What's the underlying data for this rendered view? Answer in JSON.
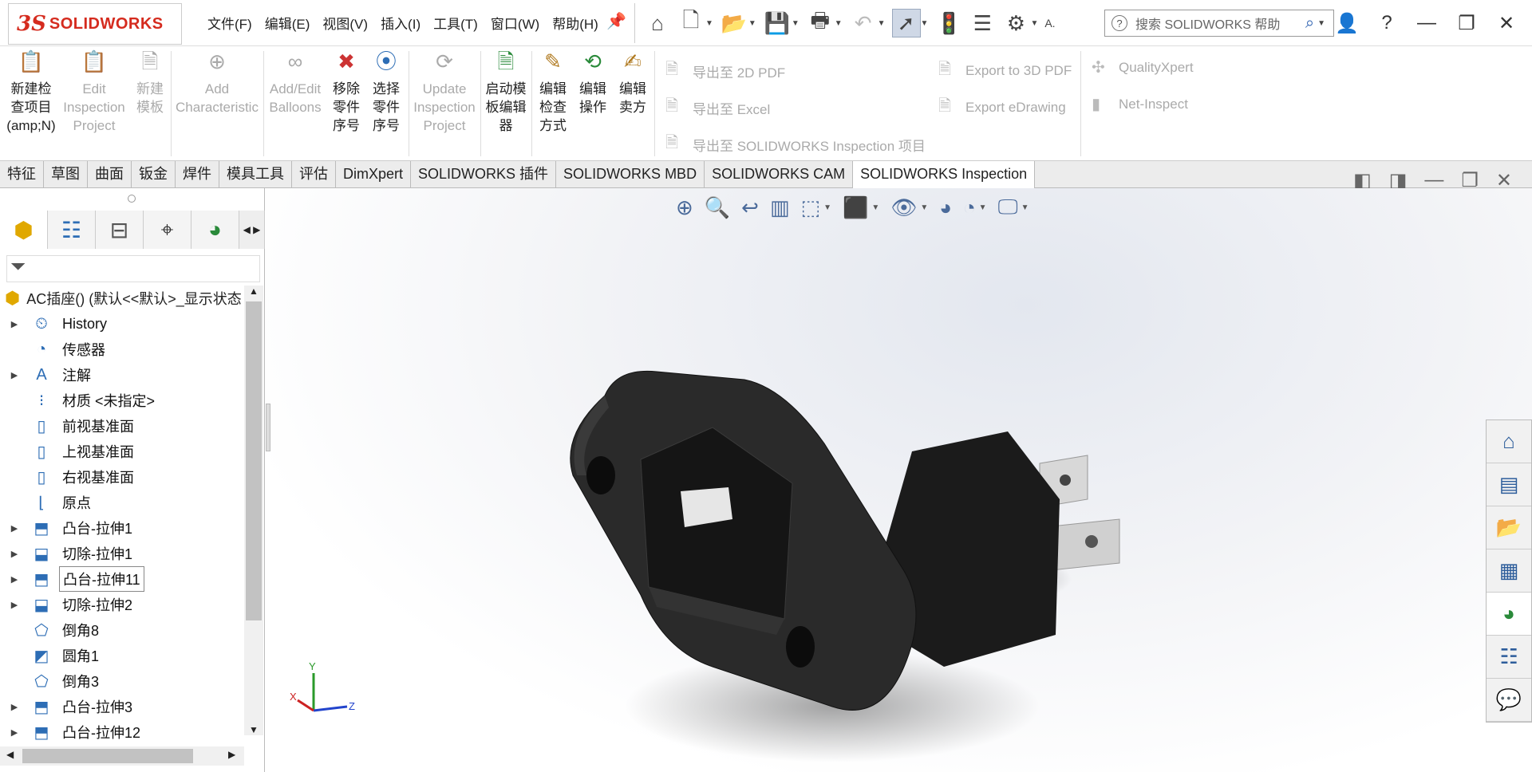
{
  "app": {
    "brand_ds": "3S",
    "brand_name": "SOLIDWORKS"
  },
  "menu": [
    "文件(F)",
    "编辑(E)",
    "视图(V)",
    "插入(I)",
    "工具(T)",
    "窗口(W)",
    "帮助(H)"
  ],
  "search": {
    "placeholder": "搜索 SOLIDWORKS 帮助",
    "prefix": "A."
  },
  "ribbon": {
    "new_inspection": "新建检\n查项目\n(amp;N)",
    "edit_inspection": "Edit\nInspection\nProject",
    "new_template": "新建\n模板",
    "add_characteristic": "Add\nCharacteristic",
    "add_edit_balloons": "Add/Edit\nBalloons",
    "remove_part_number": "移除\n零件\n序号",
    "select_part_number": "选择\n零件\n序号",
    "update_inspection": "Update\nInspection\nProject",
    "launch_template_editor": "启动模\n板编辑\n器",
    "edit_inspection_method": "编辑\n检查\n方式",
    "edit_operation": "编辑\n操作",
    "edit_vendor": "编辑\n卖方",
    "export_2d_pdf": "导出至 2D PDF",
    "export_excel": "导出至 Excel",
    "export_inspection": "导出至 SOLIDWORKS Inspection 项目",
    "export_3d_pdf": "Export to 3D PDF",
    "export_edrawing": "Export eDrawing",
    "qualityxpert": "QualityXpert",
    "net_inspect": "Net-Inspect"
  },
  "command_tabs": [
    "特征",
    "草图",
    "曲面",
    "钣金",
    "焊件",
    "模具工具",
    "评估",
    "DimXpert",
    "SOLIDWORKS 插件",
    "SOLIDWORKS MBD",
    "SOLIDWORKS CAM",
    "SOLIDWORKS Inspection"
  ],
  "active_tab": "SOLIDWORKS Inspection",
  "tree": {
    "root": "AC插座() (默认<<默认>_显示状态",
    "items": [
      {
        "label": "History",
        "expandable": true,
        "icon": "history-icon"
      },
      {
        "label": "传感器",
        "expandable": false,
        "icon": "sensor-icon"
      },
      {
        "label": "注解",
        "expandable": true,
        "icon": "annotation-icon"
      },
      {
        "label": "材质 <未指定>",
        "expandable": false,
        "icon": "material-icon"
      },
      {
        "label": "前视基准面",
        "expandable": false,
        "icon": "plane-icon"
      },
      {
        "label": "上视基准面",
        "expandable": false,
        "icon": "plane-icon"
      },
      {
        "label": "右视基准面",
        "expandable": false,
        "icon": "plane-icon"
      },
      {
        "label": "原点",
        "expandable": false,
        "icon": "origin-icon"
      },
      {
        "label": "凸台-拉伸1",
        "expandable": true,
        "icon": "extrude-icon"
      },
      {
        "label": "切除-拉伸1",
        "expandable": true,
        "icon": "cut-extrude-icon"
      },
      {
        "label": "凸台-拉伸11",
        "expandable": true,
        "icon": "extrude-icon",
        "selected": true
      },
      {
        "label": "切除-拉伸2",
        "expandable": true,
        "icon": "cut-extrude-icon"
      },
      {
        "label": "倒角8",
        "expandable": false,
        "icon": "chamfer-icon"
      },
      {
        "label": "圆角1",
        "expandable": false,
        "icon": "fillet-icon"
      },
      {
        "label": "倒角3",
        "expandable": false,
        "icon": "chamfer-icon"
      },
      {
        "label": "凸台-拉伸3",
        "expandable": true,
        "icon": "extrude-icon"
      },
      {
        "label": "凸台-拉伸12",
        "expandable": true,
        "icon": "extrude-icon"
      }
    ]
  },
  "triad": {
    "x": "X",
    "y": "Y",
    "z": "Z"
  },
  "colors": {
    "brand": "#d52b1e",
    "selection": "#cfd8e6",
    "model": "#2a2a2a"
  }
}
